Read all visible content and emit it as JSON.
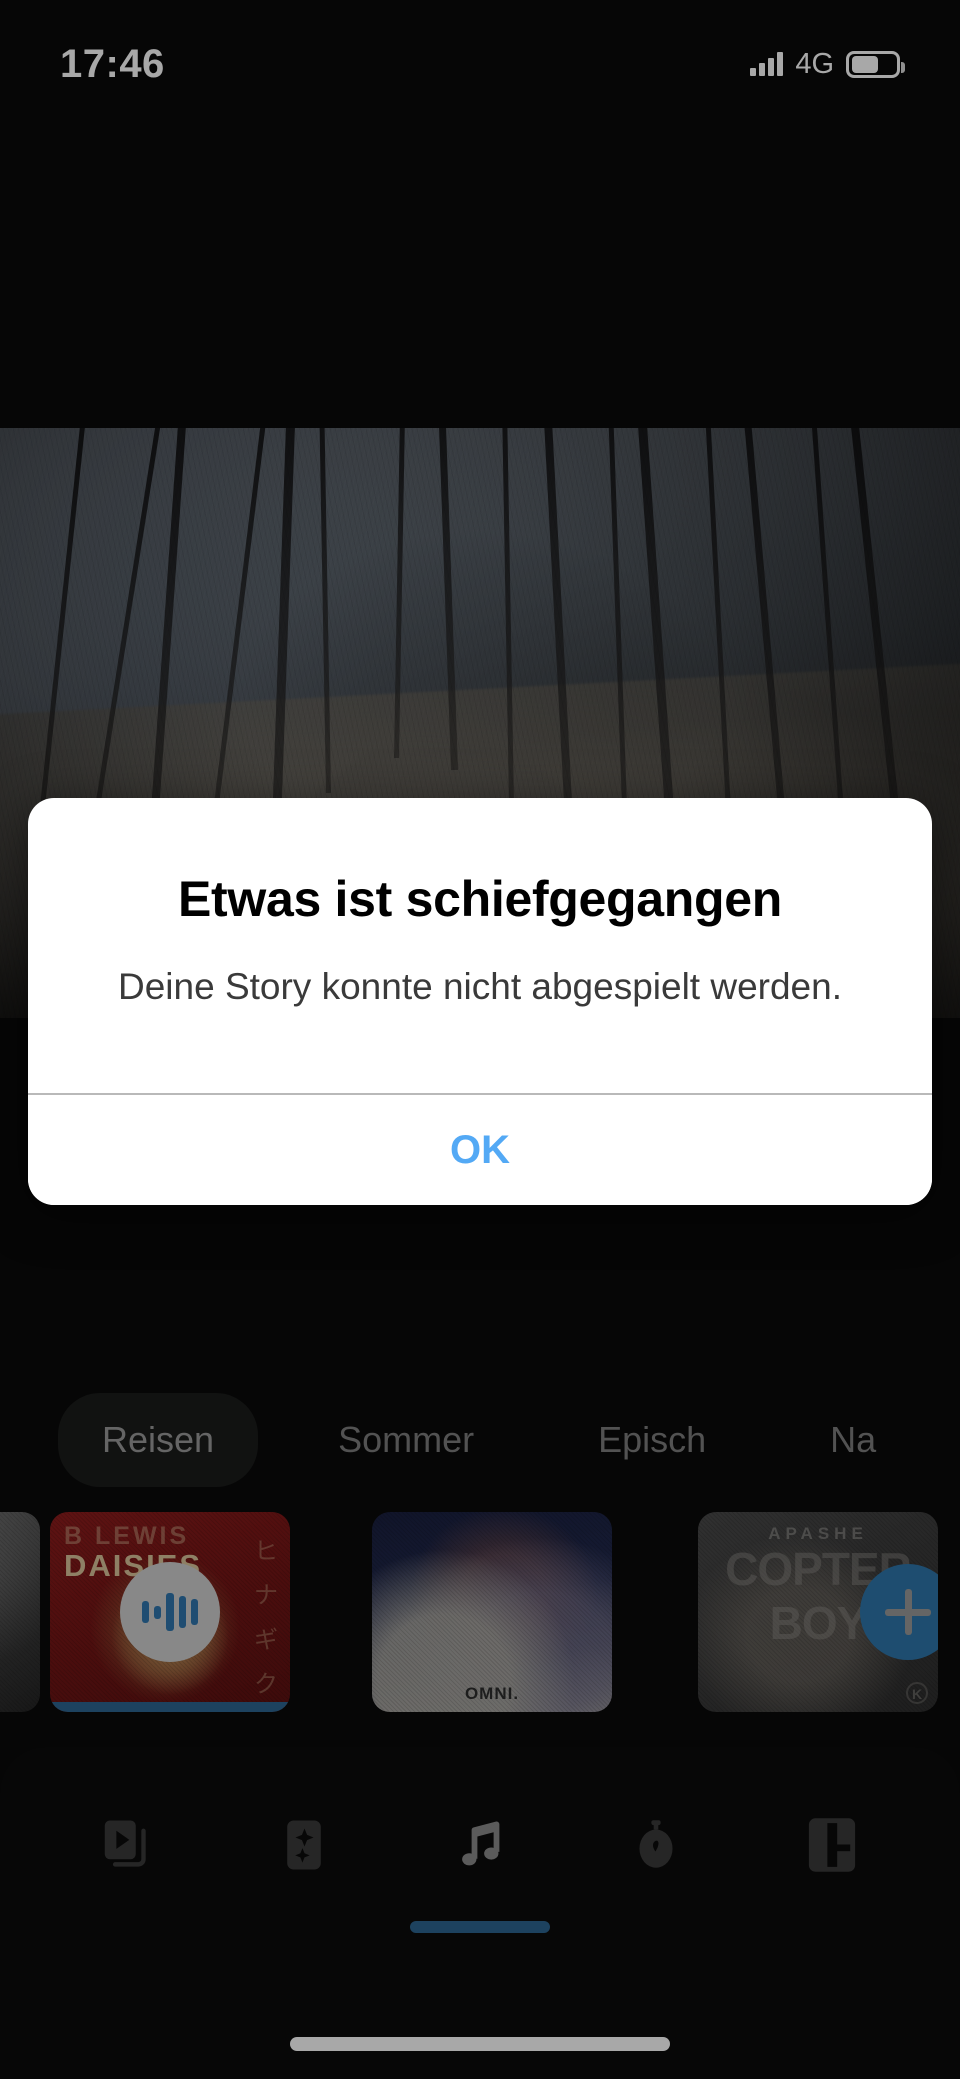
{
  "status_bar": {
    "time": "17:46",
    "network": "4G",
    "signal_icon": "signal-bars-icon",
    "battery_icon": "battery-icon"
  },
  "preview": {
    "name": "video-preview",
    "description": "forest path"
  },
  "alert": {
    "title": "Etwas ist schiefgegangen",
    "message": "Deine Story konnte nicht abgespielt werden.",
    "ok_label": "OK",
    "ok_color": "#53a9f5"
  },
  "music_panel": {
    "chips": [
      {
        "label": "Reisen",
        "active": true
      },
      {
        "label": "Sommer",
        "active": false
      },
      {
        "label": "Episch",
        "active": false
      },
      {
        "label": "Na",
        "active": false
      }
    ],
    "tracks": [
      {
        "artist": "",
        "title": "",
        "state": "partial",
        "art": "grey"
      },
      {
        "artist": "B LEWIS",
        "title": "DAISIES",
        "kana": "ヒ ナ ギ ク",
        "state": "playing",
        "art": "red",
        "badge_icon": "equalizer-icon"
      },
      {
        "artist": "",
        "title": "OMNI.",
        "state": "idle",
        "art": "blue"
      },
      {
        "artist": "APASHE",
        "title": "COPTER BOY",
        "state": "add",
        "art": "dark",
        "badge_icon": "plus-icon",
        "mark": "K"
      }
    ]
  },
  "tab_bar": {
    "items": [
      {
        "icon": "clips-icon",
        "active": false
      },
      {
        "icon": "effects-sparkle-icon",
        "active": false
      },
      {
        "icon": "music-note-icon",
        "active": true
      },
      {
        "icon": "speed-stopwatch-icon",
        "active": false
      },
      {
        "icon": "layout-canvas-icon",
        "active": false
      }
    ],
    "indicator_color": "#2d6590"
  },
  "home_indicator": {
    "name": "home-indicator"
  }
}
